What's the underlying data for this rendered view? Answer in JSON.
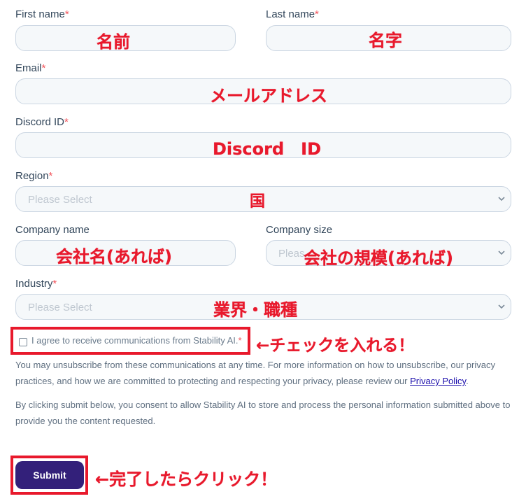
{
  "form": {
    "first_name": {
      "label": "First name",
      "required": "*",
      "annotation": "名前"
    },
    "last_name": {
      "label": "Last name",
      "required": "*",
      "annotation": "名字"
    },
    "email": {
      "label": "Email",
      "required": "*",
      "annotation": "メールアドレス"
    },
    "discord": {
      "label": "Discord ID",
      "required": "*",
      "annotation": "Discord　ID"
    },
    "region": {
      "label": "Region",
      "required": "*",
      "placeholder": "Please Select",
      "annotation": "国"
    },
    "company_name": {
      "label": "Company name",
      "annotation": "会社名(あれば)"
    },
    "company_size": {
      "label": "Company size",
      "placeholder": "Pleas",
      "annotation": "会社の規模(あれば)"
    },
    "industry": {
      "label": "Industry",
      "required": "*",
      "placeholder": "Please Select",
      "annotation": "業界・職種"
    },
    "consent": {
      "label": "I agree to receive communications from Stability AI.",
      "required": "*",
      "annotation": "←チェックを入れる！"
    },
    "unsubscribe_text": "You may unsubscribe from these communications at any time. For more information on how to unsubscribe, our privacy practices, and how we are committed to protecting and respecting your privacy, please review our",
    "privacy_link": "Privacy Policy",
    "period": ".",
    "consent_text": "By clicking submit below, you consent to allow Stability AI to store and process the personal information submitted above to provide you the content requested.",
    "submit": {
      "label": "Submit",
      "annotation": "←完了したらクリック！"
    }
  },
  "colors": {
    "annotation": "#e8192c",
    "submit_bg": "#33207a",
    "field_bg": "#f5f8fa",
    "field_border": "#cbd6e2"
  }
}
